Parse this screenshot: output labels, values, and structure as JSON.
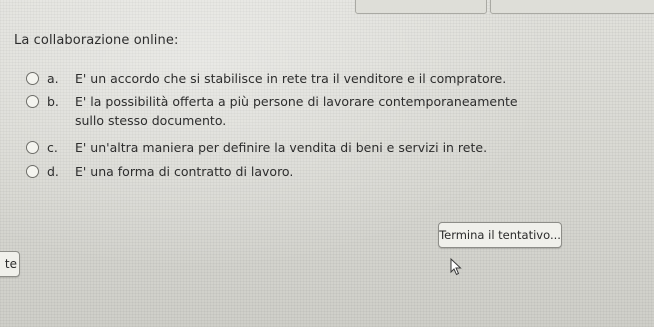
{
  "question": {
    "title": "La collaborazione online:",
    "options": [
      {
        "letter": "a.",
        "text": "E' un accordo che si stabilisce in rete tra il venditore e il compratore."
      },
      {
        "letter": "b.",
        "text": "E' la possibilità offerta a più persone di lavorare contemporaneamente sullo stesso documento."
      },
      {
        "letter": "c.",
        "text": "E' un'altra maniera per definire la vendita di beni e servizi in rete."
      },
      {
        "letter": "d.",
        "text": "E' una forma di contratto di lavoro."
      }
    ]
  },
  "buttons": {
    "finish_label": "Termina il tentativo...",
    "previous_label": "te"
  },
  "icons": {
    "radio": "radio-circle",
    "cursor": "mouse-pointer-icon"
  },
  "colors": {
    "background": "#dcdcd6",
    "text": "#2d2d2d",
    "button_bg": "#f0f0eb",
    "border": "#8d8d88"
  }
}
